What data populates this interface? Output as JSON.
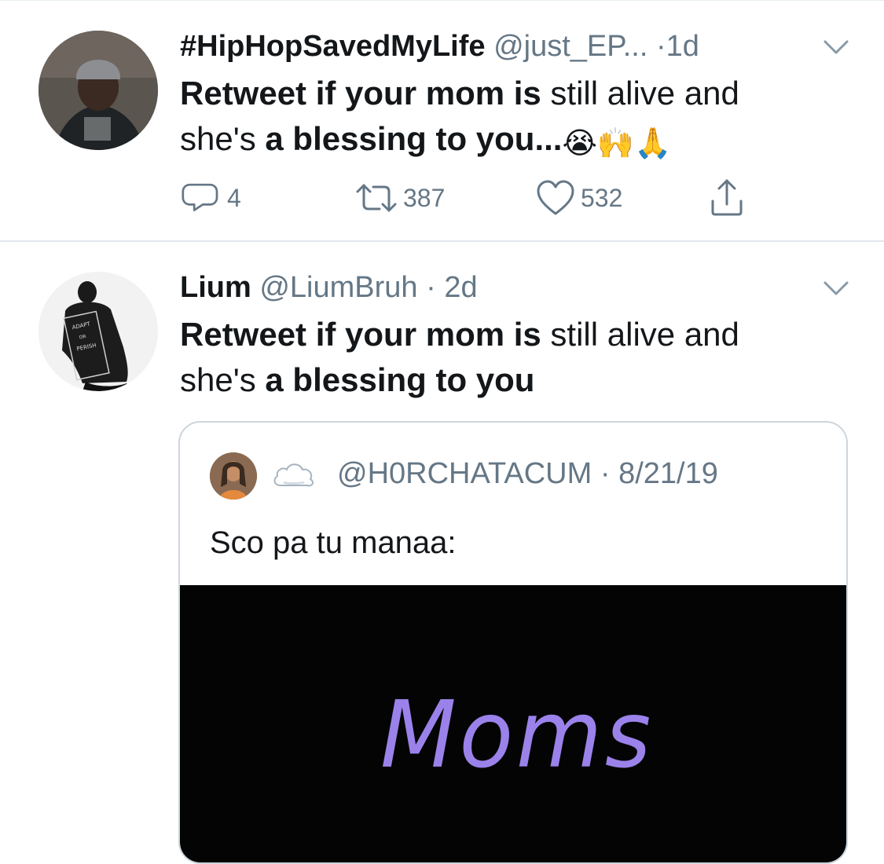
{
  "tweets": [
    {
      "name": "#HipHopSavedMyLife",
      "handle": "@just_EP...",
      "dot": " ·",
      "time": "1d",
      "text_bold_1": "Retweet if your mom is",
      "text_plain_1": " still alive and",
      "text_plain_2": "she's ",
      "text_bold_2": "a blessing to you...",
      "emojis": [
        "😭",
        "🙌",
        "🙏"
      ],
      "reply_count": "4",
      "retweet_count": "387",
      "like_count": "532",
      "icons": [
        "reply-icon",
        "retweet-icon",
        "like-icon",
        "share-icon",
        "chevron-down-icon"
      ]
    },
    {
      "name": "Lium",
      "handle": "@LiumBruh",
      "dot": " ·",
      "time": "2d",
      "text_bold_1": "Retweet if your mom is",
      "text_plain_1": " still alive and",
      "text_plain_2": "she's ",
      "text_bold_2": "a blessing to you",
      "icons": [
        "chevron-down-icon"
      ]
    }
  ],
  "quote": {
    "emoji": "☁️",
    "handle": "@H0RCHATACUM",
    "dot": " ·",
    "time": "8/21/19",
    "text": "Sco pa tu manaa:",
    "media_title": "Moms",
    "media_title_color": "#9b82ea"
  },
  "colors": {
    "text": "#14171a",
    "secondary": "#657786",
    "divider": "#e1e8ed",
    "quote_border": "#ccd6dd"
  }
}
